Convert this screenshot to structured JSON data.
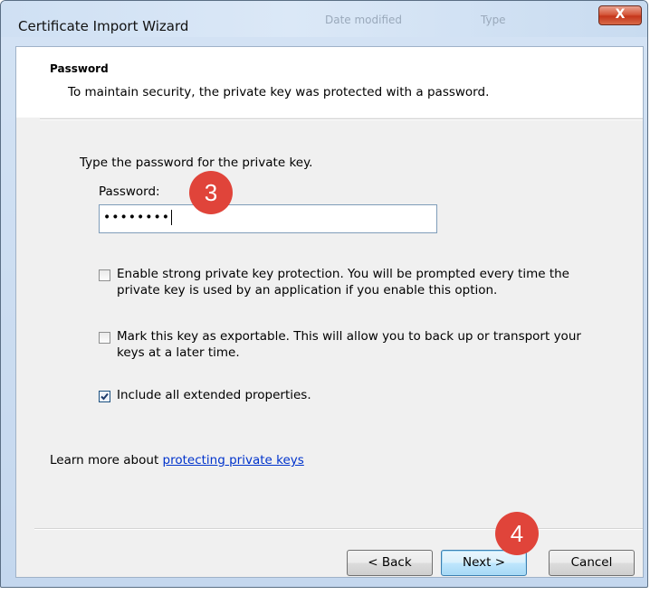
{
  "window": {
    "title": "Certificate Import Wizard",
    "ghost_columns": [
      "Date modified",
      "Type"
    ],
    "close_glyph": "X"
  },
  "header": {
    "title": "Password",
    "description": "To maintain security, the private key was protected with a password."
  },
  "body": {
    "instruction": "Type the password for the private key.",
    "password_label": "Password:",
    "password_value": "••••••••"
  },
  "options": [
    {
      "line1": "Enable strong private key protection. You will be prompted every time the",
      "line2": "private key is used by an application if you enable this option.",
      "checked": false
    },
    {
      "line1": "Mark this key as exportable. This will allow you to back up or transport your",
      "line2": "keys at a later time.",
      "checked": false
    },
    {
      "line1": "Include all extended properties.",
      "line2": "",
      "checked": true
    }
  ],
  "learn_more": {
    "prefix": "Learn more about ",
    "link": "protecting private keys"
  },
  "buttons": {
    "back": "< Back",
    "next": "Next >",
    "cancel": "Cancel"
  },
  "annotations": {
    "step_password": "3",
    "step_next": "4",
    "badge_color": "#e0443a"
  },
  "icons": {
    "close": "close-icon",
    "checkmark": "checkmark-icon"
  }
}
